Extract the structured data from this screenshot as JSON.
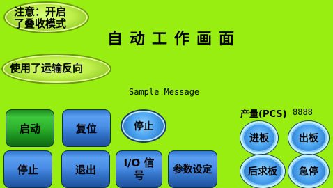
{
  "notices": {
    "stack_mode": "注意：开启\n了叠收模式",
    "reverse": "使用了运输反向"
  },
  "screen_title": "自动工作画面",
  "message": "Sample Message",
  "production": {
    "label": "产量(PCS)",
    "value": "8888"
  },
  "buttons": {
    "start": "启动",
    "reset": "复位",
    "stop_round": "停止",
    "stop": "停止",
    "exit": "退出",
    "io_signal": "I/O 信号",
    "param_setting": "参数设定",
    "board_in": "进板",
    "board_out": "出板",
    "request_board": "后求板",
    "emergency_stop": "急停"
  },
  "colors": {
    "background": "#99ee11",
    "button_blue": "#4a8ee6",
    "button_green": "#2cb02e"
  }
}
